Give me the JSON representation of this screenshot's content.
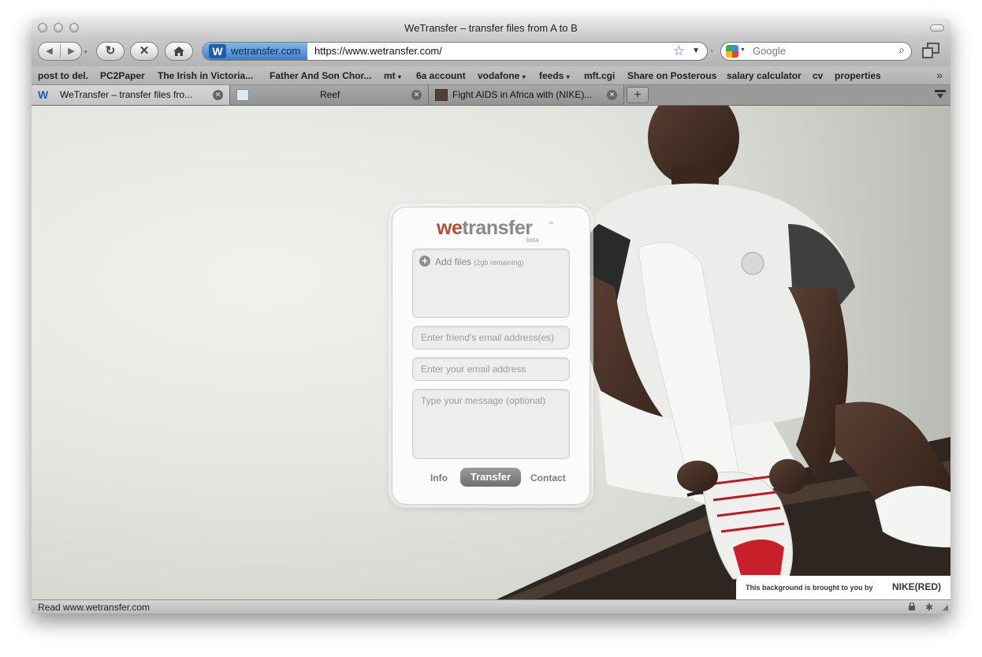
{
  "window": {
    "title": "WeTransfer – transfer files from A to B"
  },
  "toolbar": {
    "site_name": "wetransfer.com",
    "url": "https://www.wetransfer.com/",
    "search_placeholder": "Google"
  },
  "bookmarks": [
    "post to del.",
    "PC2Paper",
    "The Irish in Victoria...",
    "Father And Son Chor...",
    "mt",
    "6a account",
    "vodafone",
    "feeds",
    "mft.cgi",
    "Share on Posterous",
    "salary calculator",
    "cv",
    "properties"
  ],
  "tabs": [
    {
      "label": "WeTransfer – transfer files fro..."
    },
    {
      "label": "Reef"
    },
    {
      "label": "Fight AIDS in Africa with (NIKE)..."
    }
  ],
  "panel": {
    "logo_we": "we",
    "logo_rest": "transfer",
    "logo_tm": "™",
    "logo_beta": "beta",
    "add_files_label": "Add files",
    "add_files_note": "(2gb remaining)",
    "friend_email_placeholder": "Enter friend's email address(es)",
    "your_email_placeholder": "Enter your email address",
    "message_placeholder": "Type your message (optional)",
    "info_label": "Info",
    "transfer_label": "Transfer",
    "contact_label": "Contact"
  },
  "credit": {
    "text": "This background is brought to you by",
    "brand": "NIKE(RED)"
  },
  "status": {
    "text": "Read www.wetransfer.com"
  },
  "colors": {
    "logo_accent": "#b14f3a",
    "shoe_red": "#c8202a"
  }
}
